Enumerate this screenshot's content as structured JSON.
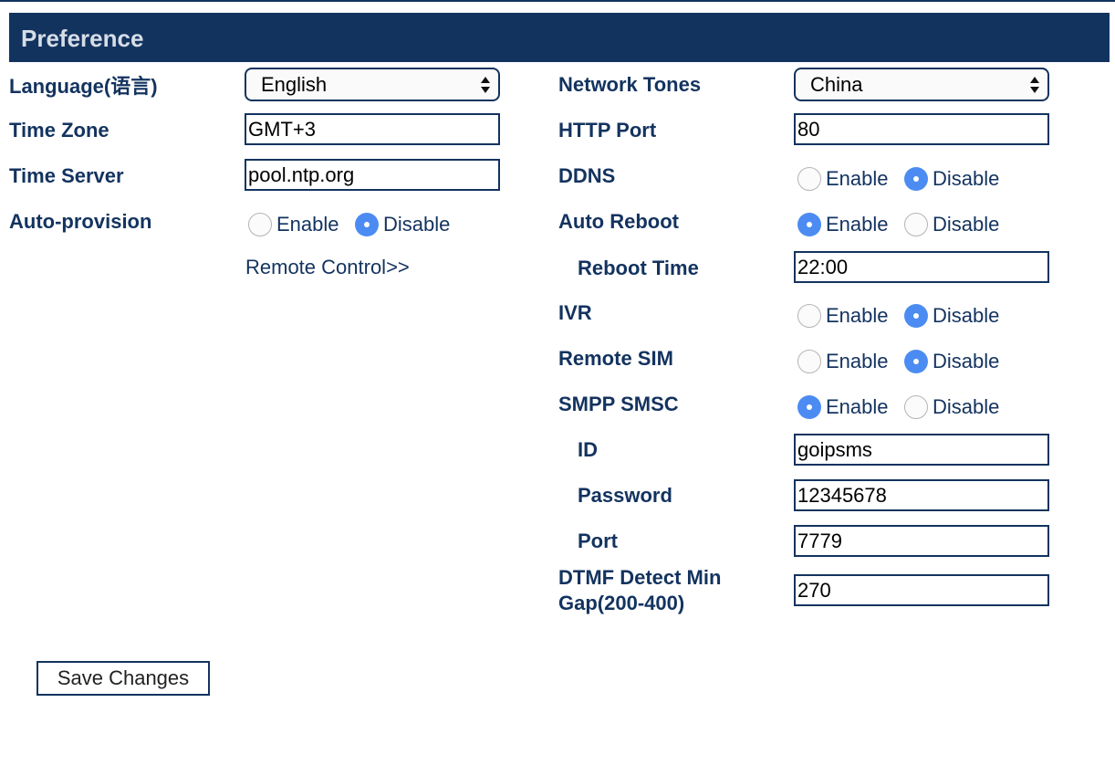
{
  "section_title": "Preference",
  "left": {
    "language": {
      "label": "Language(语言)",
      "value": "English"
    },
    "time_zone": {
      "label": "Time Zone",
      "value": "GMT+3"
    },
    "time_server": {
      "label": "Time Server",
      "value": "pool.ntp.org"
    },
    "auto_provision": {
      "label": "Auto-provision",
      "enable_label": "Enable",
      "disable_label": "Disable",
      "selected": "Disable"
    },
    "remote_control_link": "Remote Control>>"
  },
  "right": {
    "network_tones": {
      "label": "Network Tones",
      "value": "China"
    },
    "http_port": {
      "label": "HTTP Port",
      "value": "80"
    },
    "ddns": {
      "label": "DDNS",
      "enable_label": "Enable",
      "disable_label": "Disable",
      "selected": "Disable"
    },
    "auto_reboot": {
      "label": "Auto Reboot",
      "enable_label": "Enable",
      "disable_label": "Disable",
      "selected": "Enable"
    },
    "reboot_time": {
      "label": "Reboot Time",
      "value": "22:00"
    },
    "ivr": {
      "label": "IVR",
      "enable_label": "Enable",
      "disable_label": "Disable",
      "selected": "Disable"
    },
    "remote_sim": {
      "label": "Remote SIM",
      "enable_label": "Enable",
      "disable_label": "Disable",
      "selected": "Disable"
    },
    "smpp_smsc": {
      "label": "SMPP SMSC",
      "enable_label": "Enable",
      "disable_label": "Disable",
      "selected": "Enable"
    },
    "smpp_id": {
      "label": "ID",
      "value": "goipsms"
    },
    "smpp_password": {
      "label": "Password",
      "value": "12345678"
    },
    "smpp_port": {
      "label": "Port",
      "value": "7779"
    },
    "dtmf_gap": {
      "label": "DTMF Detect Min Gap(200-400)",
      "value": "270"
    }
  },
  "save_button": "Save Changes",
  "colors": {
    "header_bg": "#13335f",
    "label": "#13335f",
    "radio_checked": "#4c8cf2"
  }
}
